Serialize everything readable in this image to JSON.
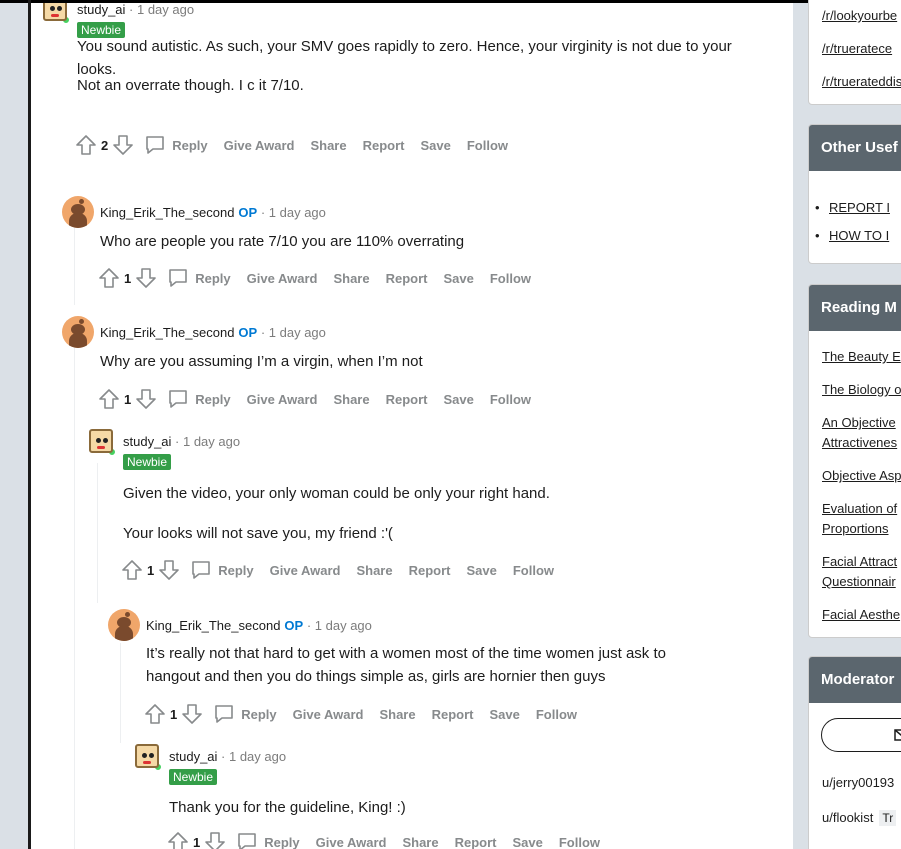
{
  "comments": [
    {
      "user": "study_ai",
      "time": "1 day ago",
      "flair": "Newbie",
      "op": "",
      "paragraphs": [
        "You sound autistic. As such, your SMV goes rapidly to zero. Hence, your virginity is not due to your looks.",
        "Not an overrate though. I c it 7/10."
      ],
      "votes": "2"
    },
    {
      "user": "King_Erik_The_second",
      "time": "1 day ago",
      "flair": "",
      "op": "OP",
      "paragraphs": [
        "Who are people you rate 7/10 you are 110% overrating"
      ],
      "votes": "1"
    },
    {
      "user": "King_Erik_The_second",
      "time": "1 day ago",
      "flair": "",
      "op": "OP",
      "paragraphs": [
        "Why are you assuming I’m a virgin, when I’m not"
      ],
      "votes": "1"
    },
    {
      "user": "study_ai",
      "time": "1 day ago",
      "flair": "Newbie",
      "op": "",
      "paragraphs": [
        "Given the video, your only woman could be only your right hand.",
        "Your looks will not save you, my friend :'("
      ],
      "votes": "1"
    },
    {
      "user": "King_Erik_The_second",
      "time": "1 day ago",
      "flair": "",
      "op": "OP",
      "paragraphs": [
        "It’s really not that hard to get with a women most of the time women just ask to hangout and then you do things simple as, girls are hornier then guys"
      ],
      "votes": "1"
    },
    {
      "user": "study_ai",
      "time": "1 day ago",
      "flair": "Newbie",
      "op": "",
      "paragraphs": [
        "Thank you for the guideline, King! :)"
      ],
      "votes": "1"
    }
  ],
  "actions": {
    "reply": "Reply",
    "award": "Give Award",
    "share": "Share",
    "report": "Report",
    "save": "Save",
    "follow": "Follow"
  },
  "sidebar": {
    "top_links": [
      "/r/lookyourbe",
      "/r/trueratece",
      "/r/truerateddis"
    ],
    "other_title": "Other Usef",
    "other_items": [
      "REPORT I",
      "HOW TO I"
    ],
    "reading_title": "Reading M",
    "reading_links": [
      "The Beauty E",
      "The Biology o",
      "An Objective",
      "Attractivenes",
      "Objective Asp",
      "Evaluation of",
      "Proportions",
      "Facial Attract",
      "Questionnair",
      "Facial Aesthe"
    ],
    "mod_title": "Moderator",
    "mods": [
      "u/jerry00193",
      "u/flookist"
    ],
    "mod_tag": "Tr"
  },
  "colors": {
    "op": "#0079d3",
    "flair": "#349e48",
    "online": "#46d160",
    "card_header": "#5b666e"
  }
}
